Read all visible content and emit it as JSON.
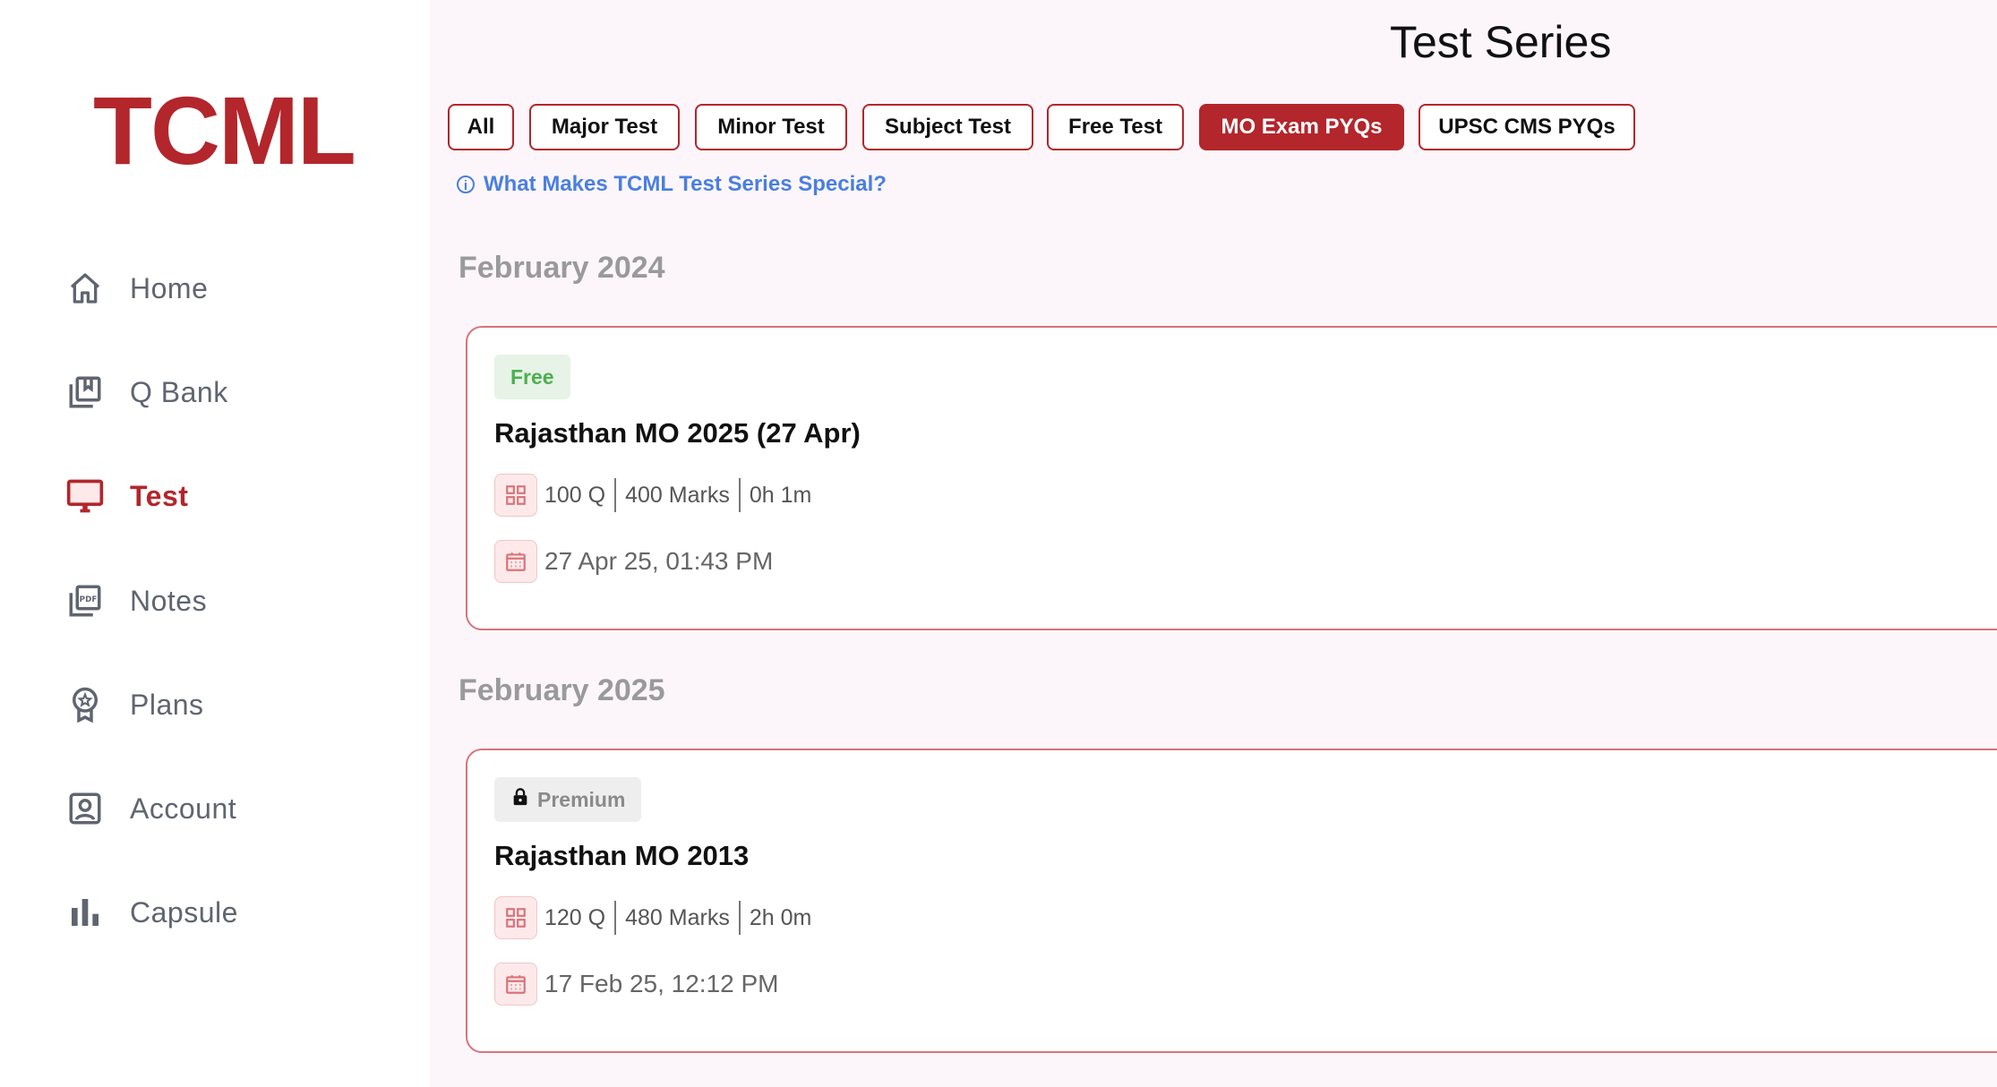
{
  "brand": {
    "logo_text": "TCML",
    "color": "#b3262b"
  },
  "sidebar": {
    "items": [
      {
        "label": "Home",
        "icon": "home-icon",
        "active": false
      },
      {
        "label": "Q Bank",
        "icon": "bookmark-stack-icon",
        "active": false
      },
      {
        "label": "Test",
        "icon": "monitor-icon",
        "active": true
      },
      {
        "label": "Notes",
        "icon": "pdf-icon",
        "active": false
      },
      {
        "label": "Plans",
        "icon": "award-icon",
        "active": false
      },
      {
        "label": "Account",
        "icon": "account-icon",
        "active": false
      },
      {
        "label": "Capsule",
        "icon": "bar-chart-icon",
        "active": false
      }
    ]
  },
  "header": {
    "title": "Test Series"
  },
  "filters": {
    "chips": [
      {
        "label": "All",
        "selected": false
      },
      {
        "label": "Major Test",
        "selected": false
      },
      {
        "label": "Minor Test",
        "selected": false
      },
      {
        "label": "Subject Test",
        "selected": false
      },
      {
        "label": "Free Test",
        "selected": false
      },
      {
        "label": "MO Exam PYQs",
        "selected": true
      },
      {
        "label": "UPSC CMS PYQs",
        "selected": false
      }
    ]
  },
  "info_link": {
    "icon": "info-icon",
    "label": "What Makes TCML Test Series Special?",
    "color": "#4a7fe0"
  },
  "sections": [
    {
      "month": "February 2024",
      "tests": [
        {
          "badge": "Free",
          "title": "Rajasthan MO 2025 (27 Apr)",
          "questions": "100 Q",
          "marks": "400 Marks",
          "duration": "0h 1m",
          "date": "27 Apr 25, 01:43 PM"
        }
      ]
    },
    {
      "month": "February 2025",
      "tests": [
        {
          "badge": "Premium",
          "title": "Rajasthan MO 2013",
          "questions": "120 Q",
          "marks": "480 Marks",
          "duration": "2h 0m",
          "date": "17 Feb 25, 12:12 PM"
        }
      ]
    }
  ]
}
